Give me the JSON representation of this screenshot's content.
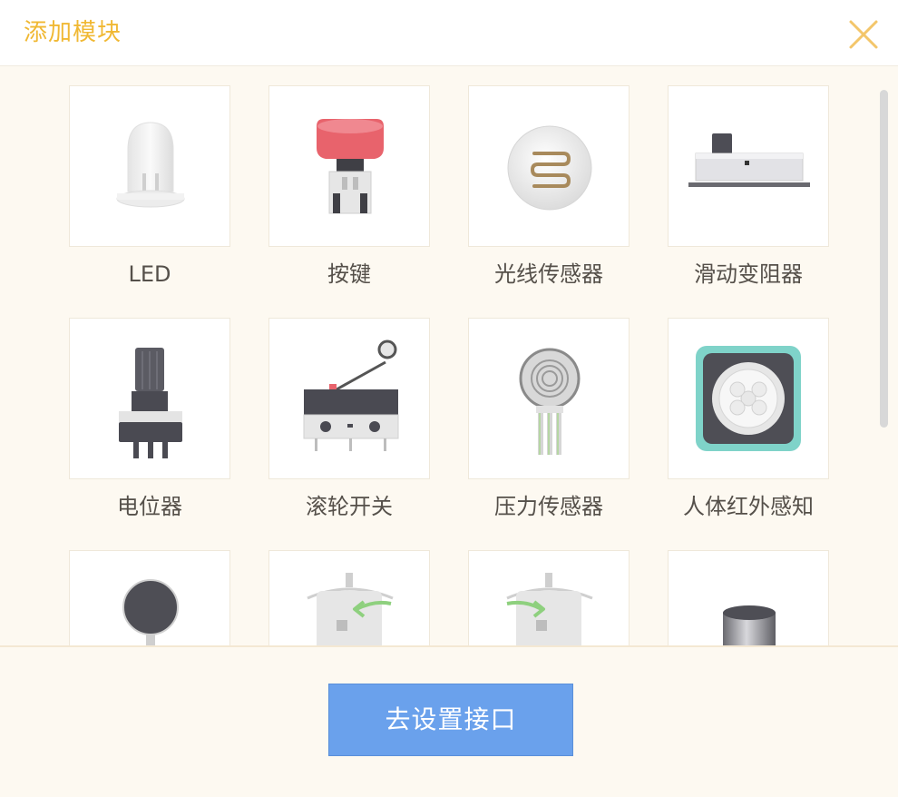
{
  "dialog": {
    "title": "添加模块",
    "close_icon": "close-icon",
    "accent_color": "#f0b833",
    "button_color": "#6aa1ec"
  },
  "modules": [
    {
      "label": "LED",
      "icon": "led-icon"
    },
    {
      "label": "按键",
      "icon": "push-button-icon"
    },
    {
      "label": "光线传感器",
      "icon": "light-sensor-icon"
    },
    {
      "label": "滑动变阻器",
      "icon": "slide-rheostat-icon"
    },
    {
      "label": "电位器",
      "icon": "potentiometer-icon"
    },
    {
      "label": "滚轮开关",
      "icon": "roller-switch-icon"
    },
    {
      "label": "压力传感器",
      "icon": "pressure-sensor-icon"
    },
    {
      "label": "人体红外感知",
      "icon": "pir-sensor-icon"
    },
    {
      "label": "",
      "icon": "sound-sensor-icon"
    },
    {
      "label": "",
      "icon": "servo-ccw-icon"
    },
    {
      "label": "",
      "icon": "servo-cw-icon"
    },
    {
      "label": "",
      "icon": "cylinder-module-icon"
    }
  ],
  "footer": {
    "confirm_label": "去设置接口"
  }
}
